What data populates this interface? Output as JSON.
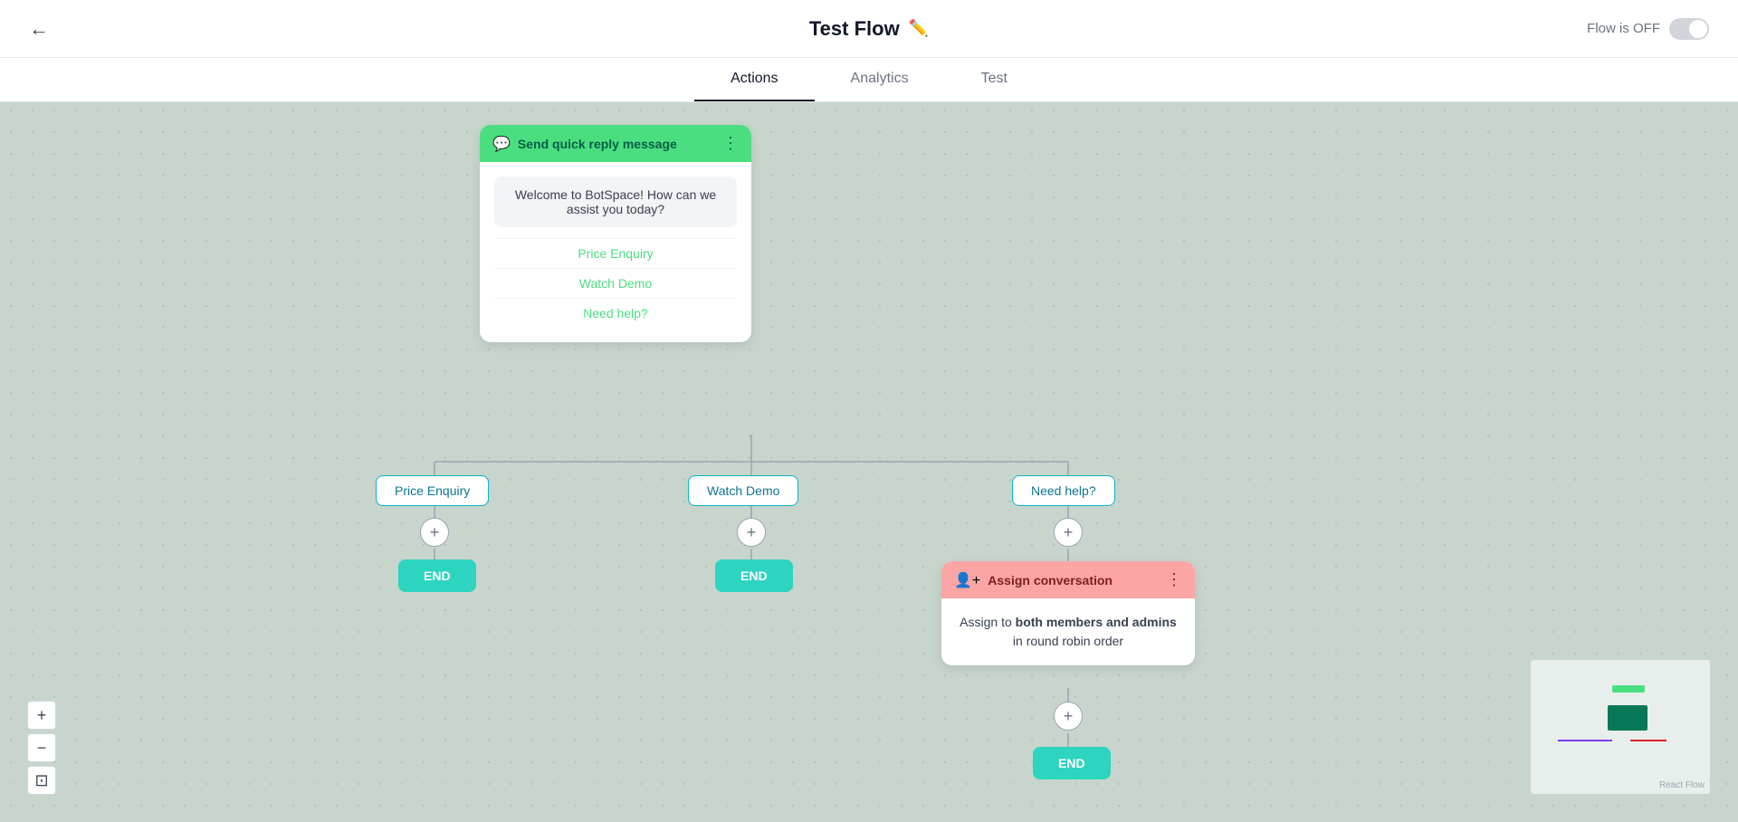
{
  "header": {
    "back_label": "←",
    "title": "Test Flow",
    "edit_icon": "✏️",
    "flow_status_label": "Flow is OFF",
    "toggle_state": "off"
  },
  "tabs": [
    {
      "id": "actions",
      "label": "Actions",
      "active": true
    },
    {
      "id": "analytics",
      "label": "Analytics",
      "active": false
    },
    {
      "id": "test",
      "label": "Test",
      "active": false
    }
  ],
  "canvas": {
    "quick_reply_node": {
      "header": "Send quick reply message",
      "message": "Welcome to BotSpace! How can we assist you today?",
      "options": [
        "Price Enquiry",
        "Watch Demo",
        "Need help?"
      ]
    },
    "branches": [
      "Price Enquiry",
      "Watch Demo",
      "Need help?"
    ],
    "end_labels": [
      "END",
      "END",
      "END"
    ],
    "assign_node": {
      "header": "Assign conversation",
      "body_prefix": "Assign to ",
      "body_bold": "both members and admins",
      "body_suffix": " in round robin order"
    }
  },
  "zoom_controls": {
    "zoom_in": "+",
    "zoom_out": "−",
    "fit": "⊡"
  },
  "minimap": {
    "label": "React Flow"
  }
}
